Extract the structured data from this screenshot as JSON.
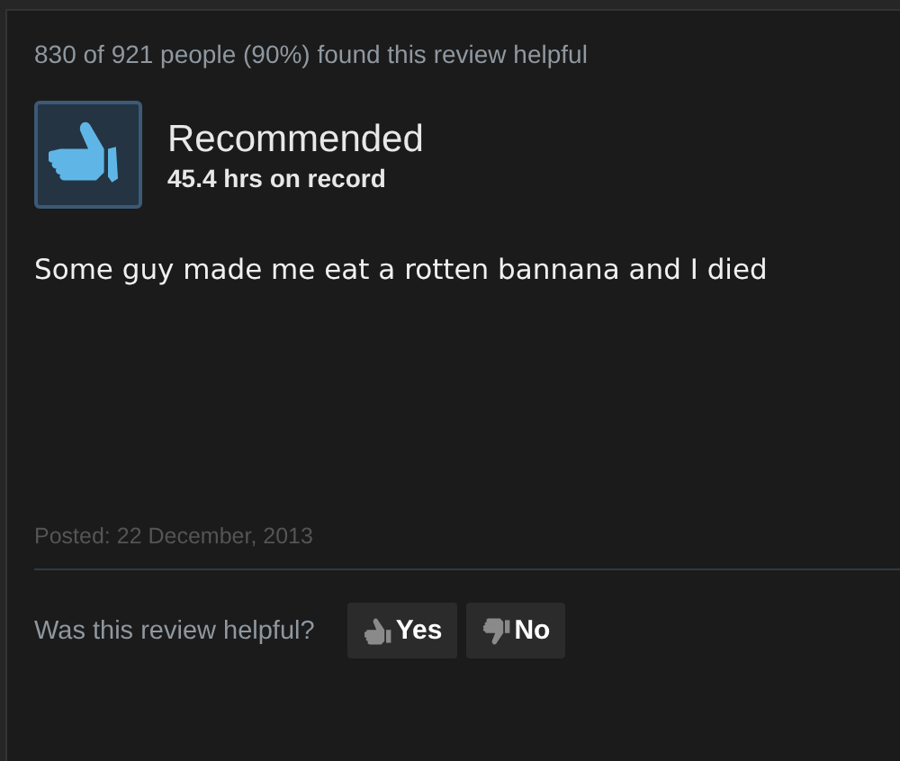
{
  "helpful_summary": "830 of 921 people (90%) found this review helpful",
  "verdict": {
    "kind": "recommended",
    "label": "Recommended",
    "hours": "45.4 hrs on record"
  },
  "review_text": "Some guy made me eat a rotten bannana and I died",
  "posted": "Posted: 22 December, 2013",
  "feedback": {
    "question": "Was this review helpful?",
    "buttons": [
      {
        "kind": "yes",
        "label": "Yes"
      },
      {
        "kind": "no",
        "label": "No"
      }
    ]
  }
}
